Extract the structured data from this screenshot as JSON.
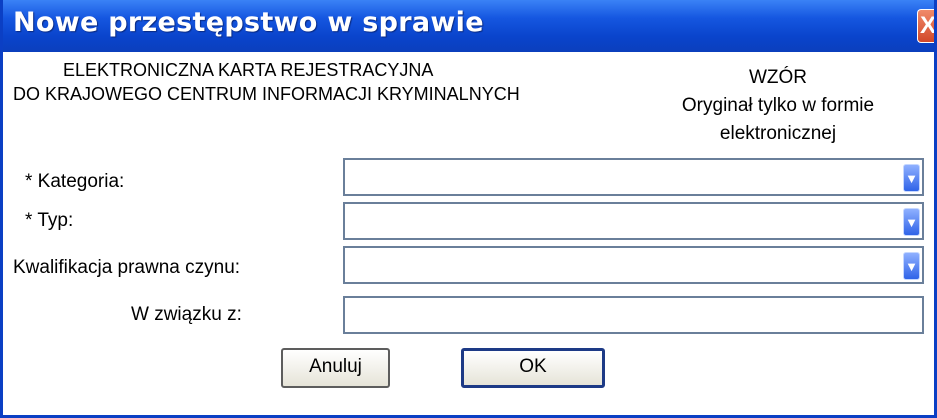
{
  "window": {
    "title": "Nowe przestępstwo w sprawie",
    "close_glyph": "X"
  },
  "header": {
    "left_line1": "ELEKTRONICZNA KARTA REJESTRACYJNA",
    "left_line2": "DO KRAJOWEGO CENTRUM INFORMACJI KRYMINALNYCH",
    "right_line1": "WZÓR",
    "right_line2": "Oryginał tylko w formie",
    "right_line3": "elektronicznej"
  },
  "form": {
    "kategoria_label": "* Kategoria:",
    "kategoria_value": "",
    "typ_label": "* Typ:",
    "typ_value": "",
    "kwalifikacja_label": "Kwalifikacja prawna czynu:",
    "kwalifikacja_value": "",
    "w_zwiazku_label": "W związku z:",
    "w_zwiazku_value": ""
  },
  "buttons": {
    "cancel_label": "Anuluj",
    "ok_label": "OK"
  },
  "icons": {
    "close": "close-icon",
    "dropdown": "chevron-down-icon"
  },
  "colors": {
    "titlebar": "#0a44cc",
    "close": "#d2482a",
    "dropdown": "#2f63e8"
  }
}
